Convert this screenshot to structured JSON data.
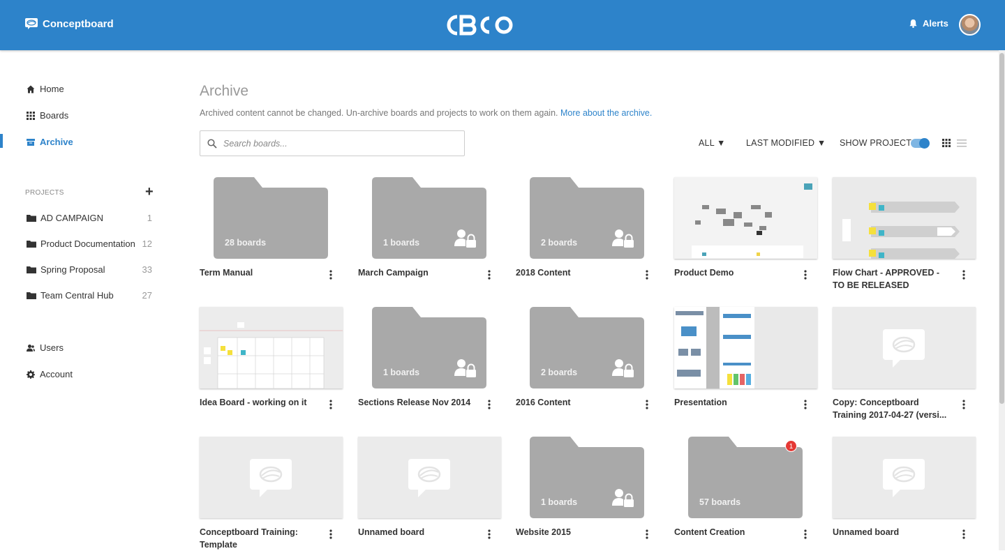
{
  "header": {
    "brand": "Conceptboard",
    "alerts_label": "Alerts"
  },
  "sidebar": {
    "nav": [
      {
        "label": "Home",
        "icon": "home-icon"
      },
      {
        "label": "Boards",
        "icon": "grid-icon"
      },
      {
        "label": "Archive",
        "icon": "archive-icon",
        "active": true
      }
    ],
    "projects_heading": "PROJECTS",
    "projects": [
      {
        "label": "AD CAMPAIGN",
        "count": "1"
      },
      {
        "label": "Product Documentation",
        "count": "12"
      },
      {
        "label": "Spring Proposal",
        "count": "33"
      },
      {
        "label": "Team Central Hub",
        "count": "27"
      }
    ],
    "bottom_nav": [
      {
        "label": "Users",
        "icon": "users-icon"
      },
      {
        "label": "Account",
        "icon": "gear-icon"
      }
    ]
  },
  "main": {
    "title": "Archive",
    "description": "Archived content cannot be changed. Un-archive boards and projects to work on them again.",
    "description_link": "More about the archive.",
    "search_placeholder": "Search boards...",
    "filter_all": "ALL ▼",
    "filter_sort": "LAST MODIFIED ▼",
    "show_projects_label": "SHOW PROJECTS",
    "accent_color": "#2d83ca"
  },
  "cards": [
    {
      "name": "Term Manual",
      "kind": "folder",
      "count": "28 boards",
      "locked": false
    },
    {
      "name": "March Campaign",
      "kind": "folder",
      "count": "1 boards",
      "locked": true
    },
    {
      "name": "2018 Content",
      "kind": "folder",
      "count": "2 boards",
      "locked": true
    },
    {
      "name": "Product Demo",
      "kind": "preview"
    },
    {
      "name": "Flow Chart - APPROVED - TO BE RELEASED",
      "kind": "preview"
    },
    {
      "name": "Idea Board - working on it",
      "kind": "preview"
    },
    {
      "name": "Sections Release Nov 2014",
      "kind": "folder",
      "count": "1 boards",
      "locked": true
    },
    {
      "name": "2016 Content",
      "kind": "folder",
      "count": "2 boards",
      "locked": true
    },
    {
      "name": "Presentation",
      "kind": "preview"
    },
    {
      "name": "Copy: Conceptboard Training 2017-04-27 (versi...",
      "kind": "empty"
    },
    {
      "name": "Conceptboard Training: Template",
      "kind": "empty"
    },
    {
      "name": "Unnamed board",
      "kind": "empty"
    },
    {
      "name": "Website 2015",
      "kind": "folder",
      "count": "1 boards",
      "locked": true
    },
    {
      "name": "Content Creation",
      "kind": "folder",
      "count": "57 boards",
      "locked": false,
      "badge": "1"
    },
    {
      "name": "Unnamed board",
      "kind": "empty"
    }
  ]
}
